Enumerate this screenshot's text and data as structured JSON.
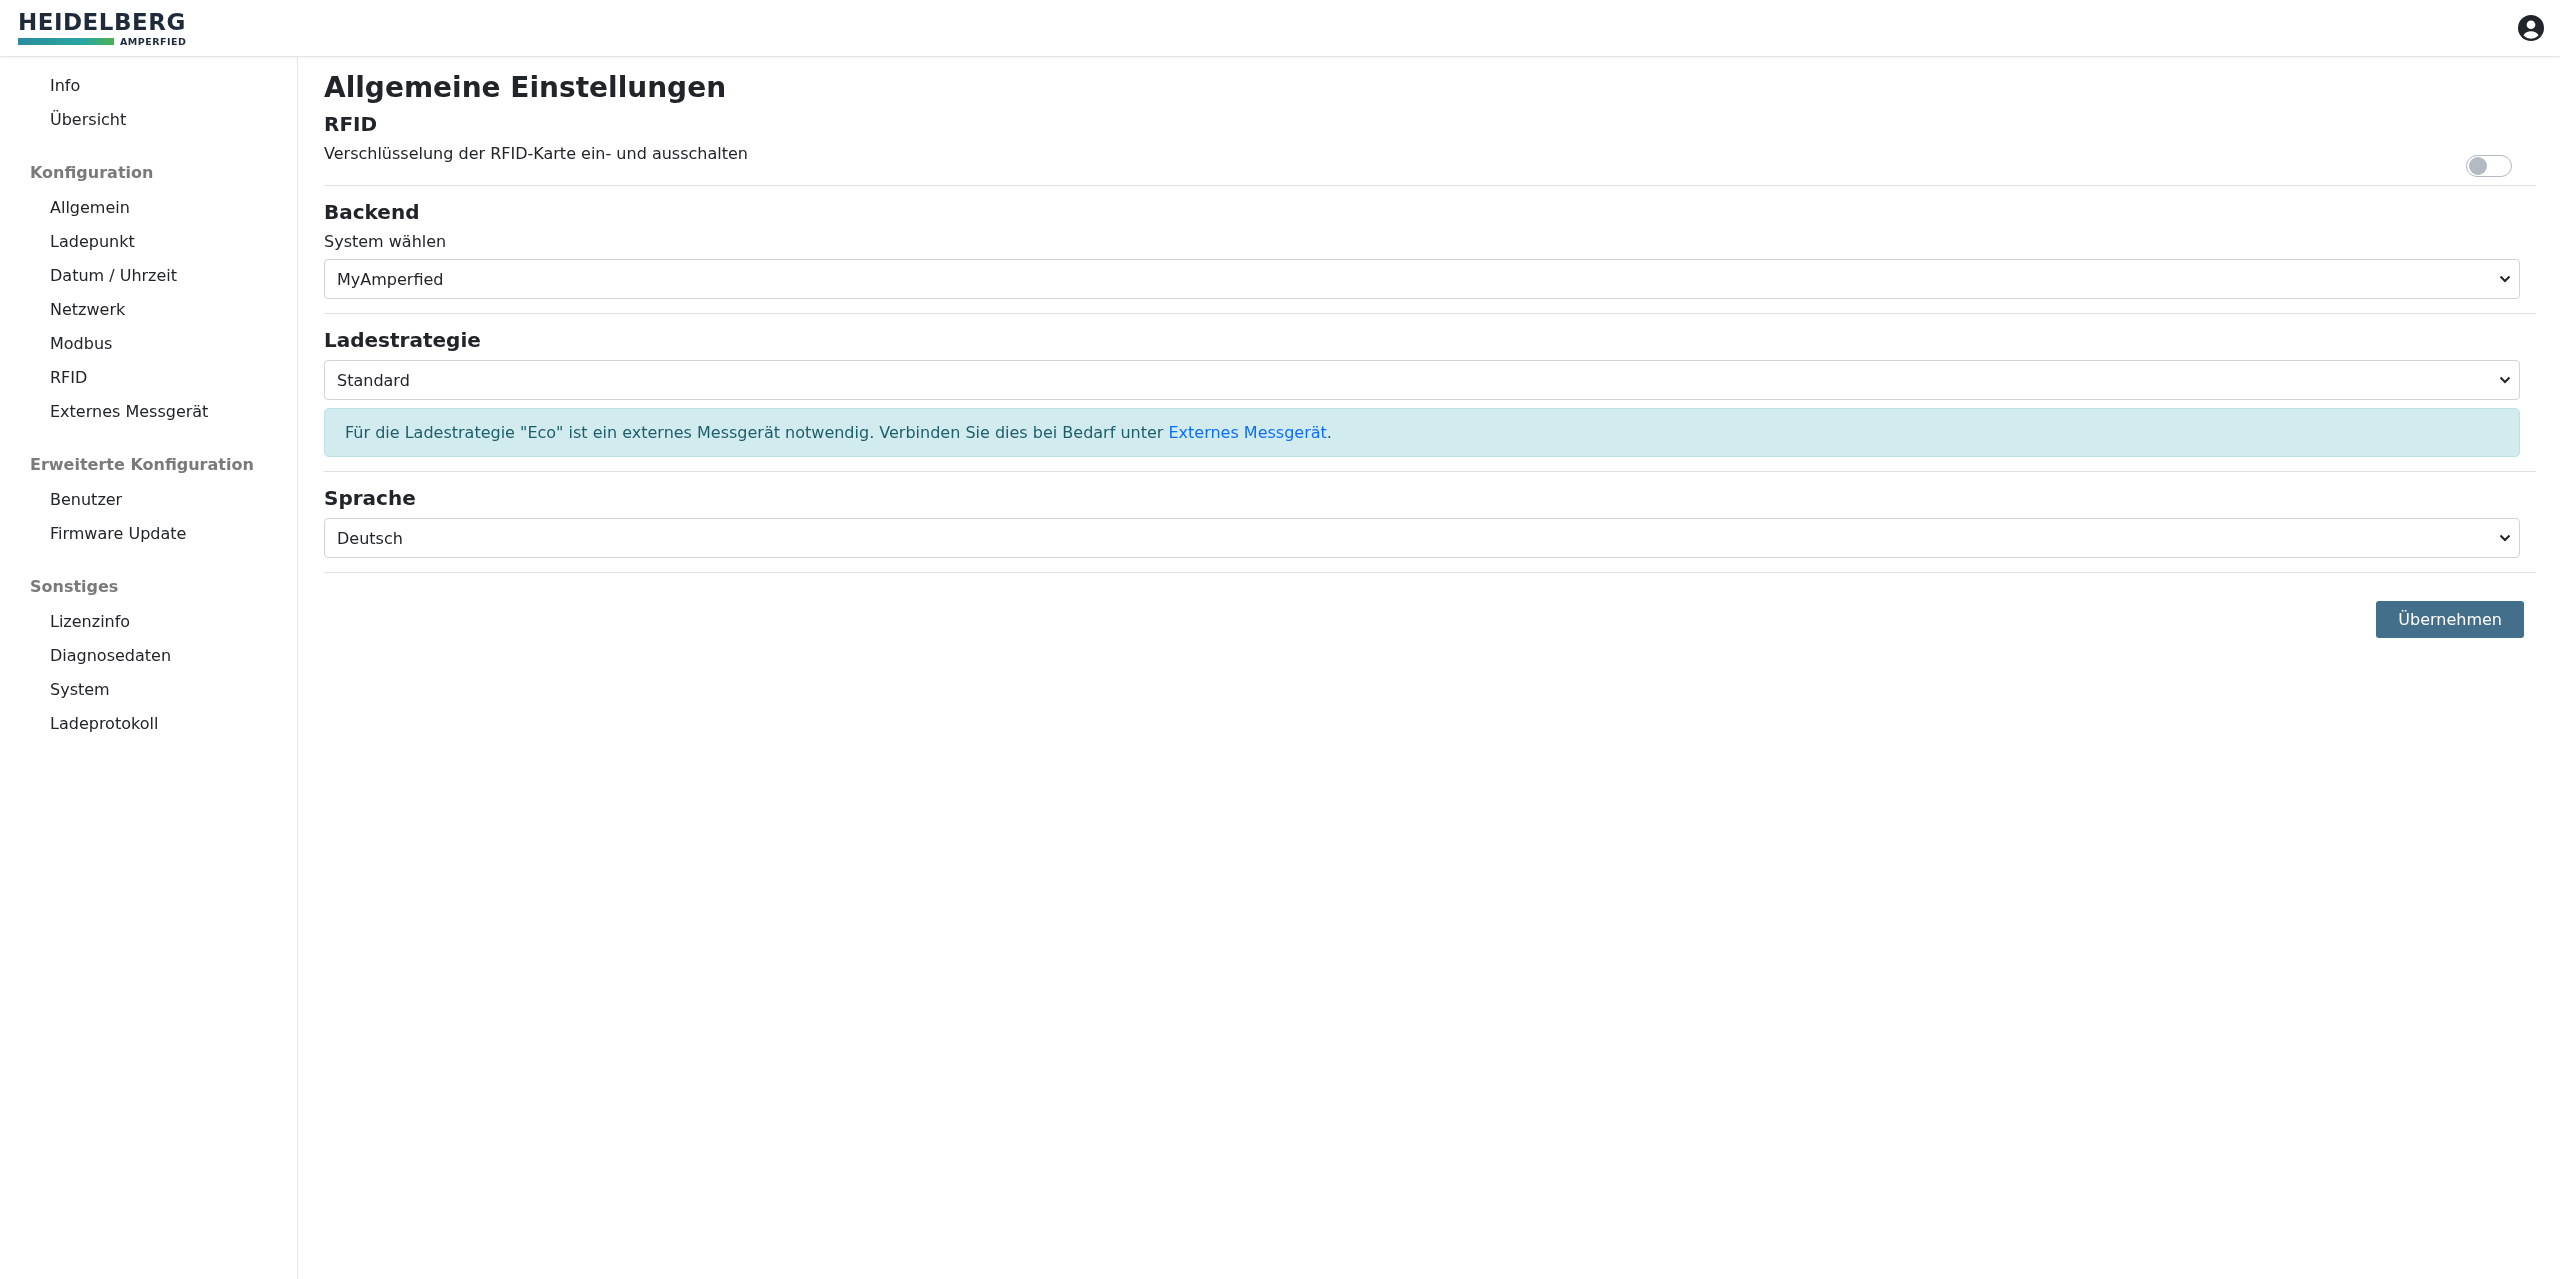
{
  "header": {
    "logo": {
      "wordmark": "HEIDELBERG",
      "subbrand": "AMPERFIED"
    }
  },
  "sidebar": {
    "groups": [
      {
        "items": [
          {
            "label": "Info"
          },
          {
            "label": "Übersicht"
          }
        ]
      },
      {
        "heading": "Konfiguration",
        "items": [
          {
            "label": "Allgemein"
          },
          {
            "label": "Ladepunkt"
          },
          {
            "label": "Datum / Uhrzeit"
          },
          {
            "label": "Netzwerk"
          },
          {
            "label": "Modbus"
          },
          {
            "label": "RFID"
          },
          {
            "label": "Externes Messgerät"
          }
        ]
      },
      {
        "heading": "Erweiterte Konfiguration",
        "items": [
          {
            "label": "Benutzer"
          },
          {
            "label": "Firmware Update"
          }
        ]
      },
      {
        "heading": "Sonstiges",
        "items": [
          {
            "label": "Lizenzinfo"
          },
          {
            "label": "Diagnosedaten"
          },
          {
            "label": "System"
          },
          {
            "label": "Ladeprotokoll"
          }
        ]
      }
    ]
  },
  "page": {
    "title": "Allgemeine Einstellungen",
    "sections": [
      {
        "kind": "toggle",
        "heading": "RFID",
        "label": "Verschlüsselung der RFID-Karte ein- und ausschalten",
        "on": false
      },
      {
        "kind": "select",
        "heading": "Backend",
        "label": "System wählen",
        "value": "MyAmperfied"
      },
      {
        "kind": "select",
        "heading": "Ladestrategie",
        "value": "Standard",
        "alert": {
          "text_before": "Für die Ladestrategie \"Eco\" ist ein externes Messgerät notwendig. Verbinden Sie dies bei Bedarf unter ",
          "link": "Externes Messgerät",
          "text_after": "."
        }
      },
      {
        "kind": "select",
        "heading": "Sprache",
        "value": "Deutsch"
      }
    ],
    "submit": "Übernehmen"
  }
}
